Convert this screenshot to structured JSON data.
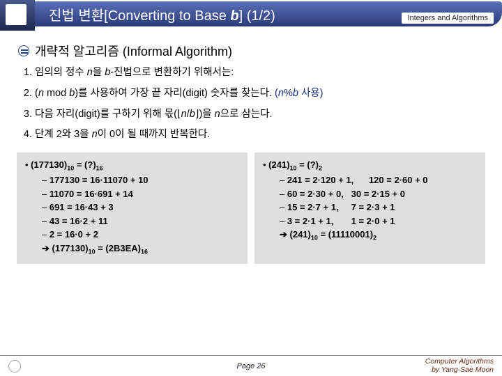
{
  "header": {
    "title_prefix": "진법 변환[Converting to Base ",
    "title_ital": "b",
    "title_suffix": "] (1/2)",
    "module": "Integers and Algorithms"
  },
  "section": {
    "title": "개략적 알고리즘 (Informal Algorithm)"
  },
  "steps": {
    "s1a": "임의의 정수 ",
    "s1b": "n",
    "s1c": "을 ",
    "s1d": "b",
    "s1e": "-진법으로 변환하기 위해서는:",
    "s2a": "(",
    "s2b": "n ",
    "s2c": "mod ",
    "s2d": "b",
    "s2e": ")를 사용하여 가장 끝 자리(digit) 숫자를 찾는다. ",
    "s2f": "(",
    "s2g": "n",
    "s2h": "%",
    "s2i": "b ",
    "s2j": "사용)",
    "s3a": "다음 자리(digit)를 구하기 위해 몫(⌊",
    "s3b": "n",
    "s3c": "/",
    "s3d": "b",
    "s3e": "⌋)을 ",
    "s3f": "n",
    "s3g": "으로 삼는다.",
    "s4a": "단계 2와 3을 ",
    "s4b": "n",
    "s4c": "이 0이 될 때까지 반복한다."
  },
  "ex1": {
    "head_a": "(177130)",
    "head_b": "10",
    "head_c": " = (?)",
    "head_d": "16",
    "l1": "177130 = 16·11070 + 10",
    "l2": "11070 = 16·691 + 14",
    "l3": "691 = 16·43 + 3",
    "l4": "43 = 16·2 + 11",
    "l5": "2 = 16·0 + 2",
    "res_a": "(177130)",
    "res_b": "10",
    "res_c": " = (2B3EA)",
    "res_d": "16"
  },
  "ex2": {
    "head_a": "(241)",
    "head_b": "10",
    "head_c": " = (?)",
    "head_d": "2",
    "l1a": "241 = 2·120 + 1,",
    "l1b": "120 = 2·60 + 0",
    "l2a": "60 = 2·30 + 0,",
    "l2b": "30 = 2·15 + 0",
    "l3a": "15 = 2·7 + 1,",
    "l3b": "7 = 2·3 + 1",
    "l4a": "3 = 2·1 + 1,",
    "l4b": "1 = 2·0 + 1",
    "res_a": "(241)",
    "res_b": "10",
    "res_c": " = (11110001)",
    "res_d": "2"
  },
  "footer": {
    "page": "Page 26",
    "credit1": "Computer Algorithms",
    "credit2": "by Yang-Sae Moon",
    "seal_text": " "
  }
}
